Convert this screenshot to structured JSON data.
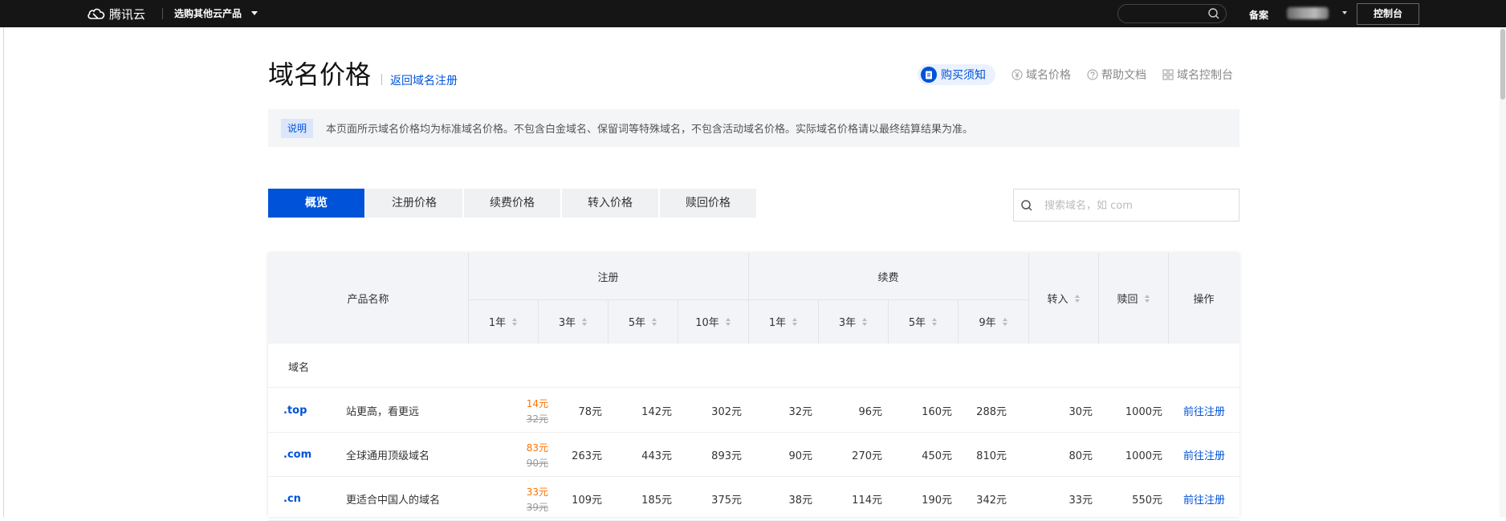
{
  "topbar": {
    "brand": "腾讯云",
    "product_switch": "选购其他云产品",
    "beian": "备案",
    "console": "控制台"
  },
  "header": {
    "title": "域名价格",
    "back_link": "返回域名注册",
    "buy_notice": "购买须知",
    "links": [
      "域名价格",
      "帮助文档",
      "域名控制台"
    ]
  },
  "notice": {
    "tag": "说明",
    "text": "本页面所示域名价格均为标准域名价格。不包含白金域名、保留词等特殊域名，不包含活动域名价格。实际域名价格请以最终结算结果为准。"
  },
  "tabs": [
    {
      "label": "概览",
      "active": true
    },
    {
      "label": "注册价格",
      "active": false
    },
    {
      "label": "续费价格",
      "active": false
    },
    {
      "label": "转入价格",
      "active": false
    },
    {
      "label": "赎回价格",
      "active": false
    }
  ],
  "search": {
    "placeholder": "搜索域名，如 com"
  },
  "table": {
    "headers": {
      "product": "产品名称",
      "register": "注册",
      "renew": "续费",
      "transfer": "转入",
      "redeem": "赎回",
      "action": "操作",
      "register_years": [
        "1年",
        "3年",
        "5年",
        "10年"
      ],
      "renew_years": [
        "1年",
        "3年",
        "5年",
        "9年"
      ]
    },
    "group": "域名",
    "rows": [
      {
        "suffix": ".top",
        "desc": "站更高，看更远",
        "reg1_now": "14元",
        "reg1_old": "32元",
        "reg3": "78元",
        "reg5": "142元",
        "reg10": "302元",
        "ren1": "32元",
        "ren3": "96元",
        "ren5": "160元",
        "ren9": "288元",
        "transfer": "30元",
        "redeem": "1000元",
        "action": "前往注册"
      },
      {
        "suffix": ".com",
        "desc": "全球通用顶级域名",
        "reg1_now": "83元",
        "reg1_old": "90元",
        "reg3": "263元",
        "reg5": "443元",
        "reg10": "893元",
        "ren1": "90元",
        "ren3": "270元",
        "ren5": "450元",
        "ren9": "810元",
        "transfer": "80元",
        "redeem": "1000元",
        "action": "前往注册"
      },
      {
        "suffix": ".cn",
        "desc": "更适合中国人的域名",
        "reg1_now": "33元",
        "reg1_old": "39元",
        "reg3": "109元",
        "reg5": "185元",
        "reg10": "375元",
        "ren1": "38元",
        "ren3": "114元",
        "ren5": "190元",
        "ren9": "342元",
        "transfer": "33元",
        "redeem": "550元",
        "action": "前往注册"
      }
    ]
  },
  "colors": {
    "accent": "#0052d9",
    "discount": "#ff7200",
    "topbar": "#151515"
  }
}
